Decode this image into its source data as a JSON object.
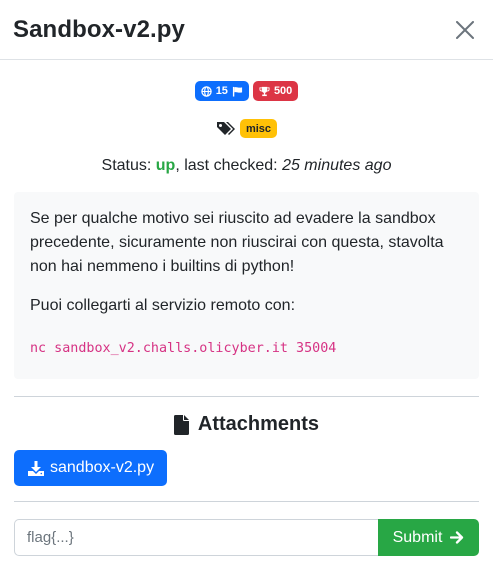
{
  "modal": {
    "title": "Sandbox-v2.py"
  },
  "badges": {
    "solves": "15",
    "points": "500"
  },
  "tags": [
    "misc"
  ],
  "status": {
    "label": "Status:",
    "value": "up",
    "checked_label": ", last checked:",
    "checked_time": "25 minutes ago"
  },
  "description": {
    "paragraph1": "Se per qualche motivo sei riuscito ad evadere la sandbox precedente, sicuramente non riuscirai con questa, stavolta non hai nemmeno i builtins di python!",
    "paragraph2": "Puoi collegarti al servizio remoto con:",
    "command": "nc sandbox_v2.challs.olicyber.it 35004"
  },
  "attachments": {
    "title": "Attachments",
    "files": [
      "sandbox-v2.py"
    ]
  },
  "flag_form": {
    "placeholder": "flag{...}",
    "value": "",
    "submit_label": "Submit"
  },
  "colors": {
    "primary": "#0d6efd",
    "danger": "#dc3545",
    "warning": "#ffc107",
    "success": "#28a745",
    "code": "#d63384"
  },
  "icons": {
    "close": "close-icon",
    "solves": "globe-icon",
    "flag": "flag-icon",
    "points": "trophy-icon",
    "tags": "tags-icon",
    "file": "file-icon",
    "download": "download-icon",
    "submit": "arrow-right-icon"
  }
}
